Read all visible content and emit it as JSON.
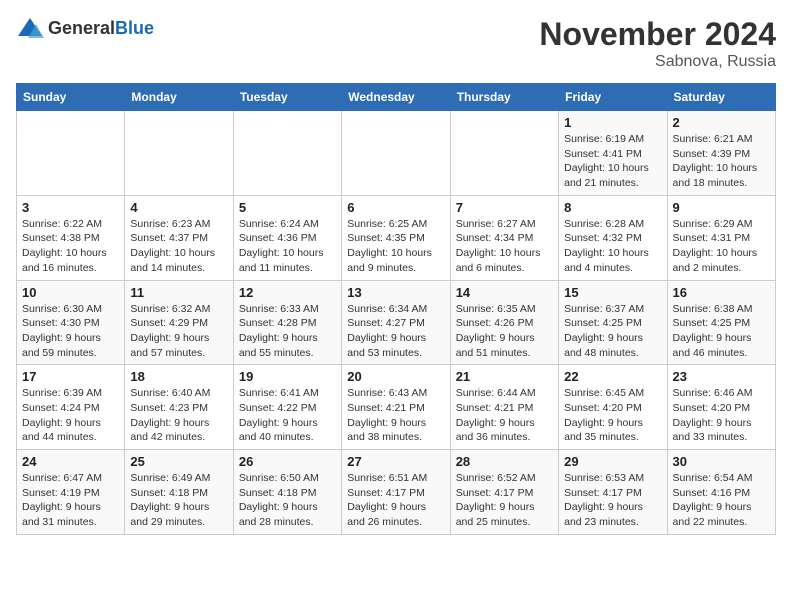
{
  "logo": {
    "text_general": "General",
    "text_blue": "Blue"
  },
  "title": "November 2024",
  "location": "Sabnova, Russia",
  "days_of_week": [
    "Sunday",
    "Monday",
    "Tuesday",
    "Wednesday",
    "Thursday",
    "Friday",
    "Saturday"
  ],
  "weeks": [
    [
      {
        "day": "",
        "info": ""
      },
      {
        "day": "",
        "info": ""
      },
      {
        "day": "",
        "info": ""
      },
      {
        "day": "",
        "info": ""
      },
      {
        "day": "",
        "info": ""
      },
      {
        "day": "1",
        "info": "Sunrise: 6:19 AM\nSunset: 4:41 PM\nDaylight: 10 hours\nand 21 minutes."
      },
      {
        "day": "2",
        "info": "Sunrise: 6:21 AM\nSunset: 4:39 PM\nDaylight: 10 hours\nand 18 minutes."
      }
    ],
    [
      {
        "day": "3",
        "info": "Sunrise: 6:22 AM\nSunset: 4:38 PM\nDaylight: 10 hours\nand 16 minutes."
      },
      {
        "day": "4",
        "info": "Sunrise: 6:23 AM\nSunset: 4:37 PM\nDaylight: 10 hours\nand 14 minutes."
      },
      {
        "day": "5",
        "info": "Sunrise: 6:24 AM\nSunset: 4:36 PM\nDaylight: 10 hours\nand 11 minutes."
      },
      {
        "day": "6",
        "info": "Sunrise: 6:25 AM\nSunset: 4:35 PM\nDaylight: 10 hours\nand 9 minutes."
      },
      {
        "day": "7",
        "info": "Sunrise: 6:27 AM\nSunset: 4:34 PM\nDaylight: 10 hours\nand 6 minutes."
      },
      {
        "day": "8",
        "info": "Sunrise: 6:28 AM\nSunset: 4:32 PM\nDaylight: 10 hours\nand 4 minutes."
      },
      {
        "day": "9",
        "info": "Sunrise: 6:29 AM\nSunset: 4:31 PM\nDaylight: 10 hours\nand 2 minutes."
      }
    ],
    [
      {
        "day": "10",
        "info": "Sunrise: 6:30 AM\nSunset: 4:30 PM\nDaylight: 9 hours\nand 59 minutes."
      },
      {
        "day": "11",
        "info": "Sunrise: 6:32 AM\nSunset: 4:29 PM\nDaylight: 9 hours\nand 57 minutes."
      },
      {
        "day": "12",
        "info": "Sunrise: 6:33 AM\nSunset: 4:28 PM\nDaylight: 9 hours\nand 55 minutes."
      },
      {
        "day": "13",
        "info": "Sunrise: 6:34 AM\nSunset: 4:27 PM\nDaylight: 9 hours\nand 53 minutes."
      },
      {
        "day": "14",
        "info": "Sunrise: 6:35 AM\nSunset: 4:26 PM\nDaylight: 9 hours\nand 51 minutes."
      },
      {
        "day": "15",
        "info": "Sunrise: 6:37 AM\nSunset: 4:25 PM\nDaylight: 9 hours\nand 48 minutes."
      },
      {
        "day": "16",
        "info": "Sunrise: 6:38 AM\nSunset: 4:25 PM\nDaylight: 9 hours\nand 46 minutes."
      }
    ],
    [
      {
        "day": "17",
        "info": "Sunrise: 6:39 AM\nSunset: 4:24 PM\nDaylight: 9 hours\nand 44 minutes."
      },
      {
        "day": "18",
        "info": "Sunrise: 6:40 AM\nSunset: 4:23 PM\nDaylight: 9 hours\nand 42 minutes."
      },
      {
        "day": "19",
        "info": "Sunrise: 6:41 AM\nSunset: 4:22 PM\nDaylight: 9 hours\nand 40 minutes."
      },
      {
        "day": "20",
        "info": "Sunrise: 6:43 AM\nSunset: 4:21 PM\nDaylight: 9 hours\nand 38 minutes."
      },
      {
        "day": "21",
        "info": "Sunrise: 6:44 AM\nSunset: 4:21 PM\nDaylight: 9 hours\nand 36 minutes."
      },
      {
        "day": "22",
        "info": "Sunrise: 6:45 AM\nSunset: 4:20 PM\nDaylight: 9 hours\nand 35 minutes."
      },
      {
        "day": "23",
        "info": "Sunrise: 6:46 AM\nSunset: 4:20 PM\nDaylight: 9 hours\nand 33 minutes."
      }
    ],
    [
      {
        "day": "24",
        "info": "Sunrise: 6:47 AM\nSunset: 4:19 PM\nDaylight: 9 hours\nand 31 minutes."
      },
      {
        "day": "25",
        "info": "Sunrise: 6:49 AM\nSunset: 4:18 PM\nDaylight: 9 hours\nand 29 minutes."
      },
      {
        "day": "26",
        "info": "Sunrise: 6:50 AM\nSunset: 4:18 PM\nDaylight: 9 hours\nand 28 minutes."
      },
      {
        "day": "27",
        "info": "Sunrise: 6:51 AM\nSunset: 4:17 PM\nDaylight: 9 hours\nand 26 minutes."
      },
      {
        "day": "28",
        "info": "Sunrise: 6:52 AM\nSunset: 4:17 PM\nDaylight: 9 hours\nand 25 minutes."
      },
      {
        "day": "29",
        "info": "Sunrise: 6:53 AM\nSunset: 4:17 PM\nDaylight: 9 hours\nand 23 minutes."
      },
      {
        "day": "30",
        "info": "Sunrise: 6:54 AM\nSunset: 4:16 PM\nDaylight: 9 hours\nand 22 minutes."
      }
    ]
  ]
}
